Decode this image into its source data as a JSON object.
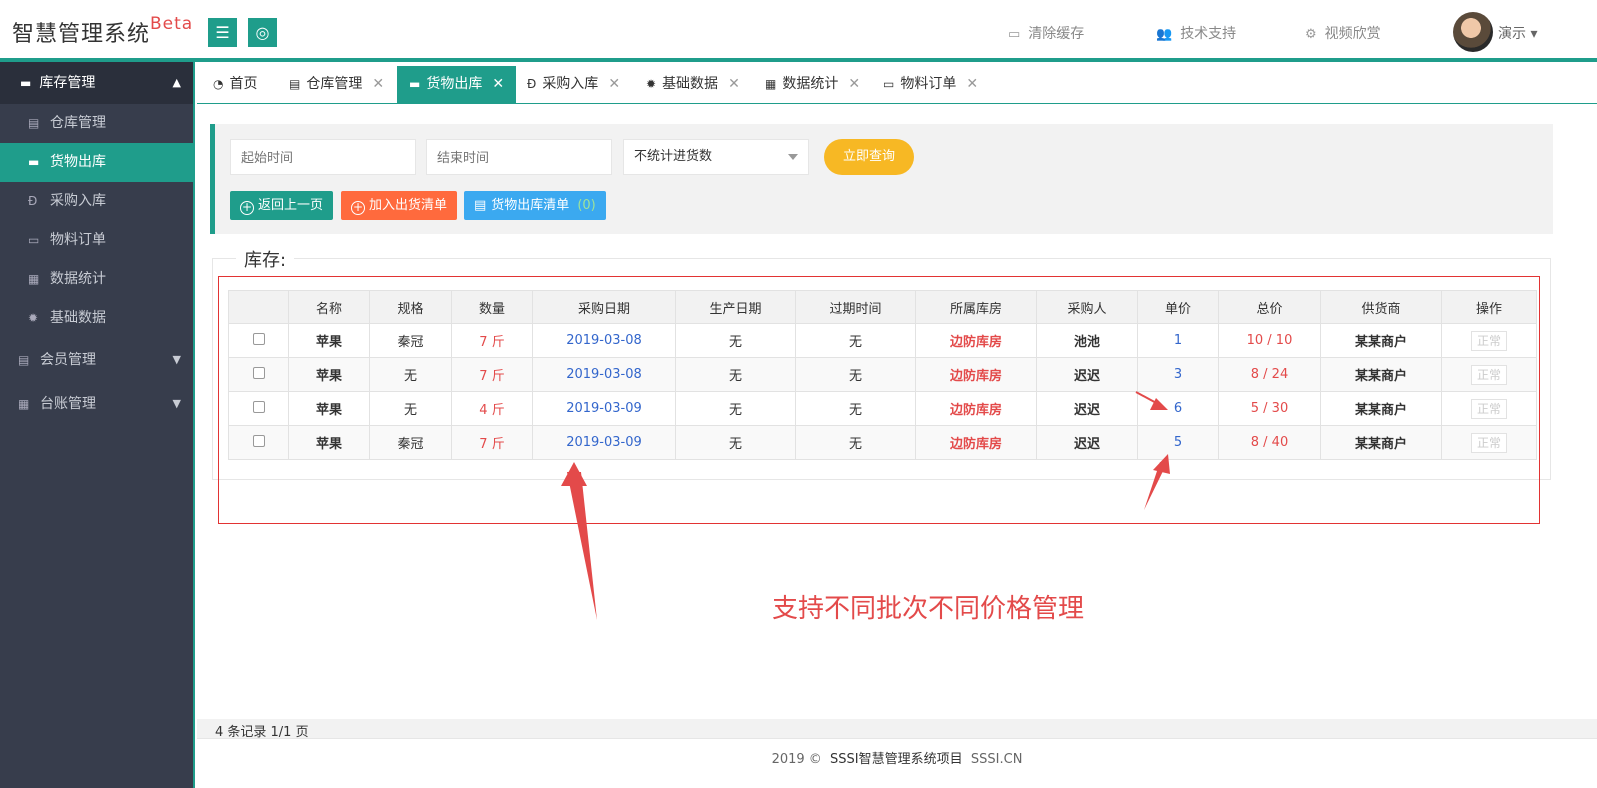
{
  "header": {
    "logo_text": "智慧管理系统",
    "logo_sup": "Beta",
    "menu_icon": "☰",
    "globe_icon": "◎",
    "links": [
      {
        "icon": "▭",
        "label": "清除缓存"
      },
      {
        "icon": "👥",
        "label": "技术支持"
      },
      {
        "icon": "⚙",
        "label": "视频欣赏"
      }
    ],
    "user_name": "演示 ▾"
  },
  "sidebar": {
    "group_open": {
      "icon": "▬",
      "label": "库存管理",
      "arrow": "▲"
    },
    "items": [
      {
        "icon": "▤",
        "label": "仓库管理"
      },
      {
        "icon": "▬",
        "label": "货物出库"
      },
      {
        "icon": "Ð",
        "label": "采购入库"
      },
      {
        "icon": "▭",
        "label": "物料订单"
      },
      {
        "icon": "▦",
        "label": "数据统计"
      },
      {
        "icon": "✹",
        "label": "基础数据"
      }
    ],
    "groups": [
      {
        "icon": "▤",
        "label": "会员管理",
        "arrow": "▼"
      },
      {
        "icon": "▦",
        "label": "台账管理",
        "arrow": "▼"
      }
    ]
  },
  "tabs": [
    {
      "icon": "◔",
      "label": "首页",
      "close": ""
    },
    {
      "icon": "▤",
      "label": "仓库管理",
      "close": "✕"
    },
    {
      "icon": "▬",
      "label": "货物出库",
      "close": "✕"
    },
    {
      "icon": "Ð",
      "label": "采购入库",
      "close": "✕"
    },
    {
      "icon": "✹",
      "label": "基础数据",
      "close": "✕"
    },
    {
      "icon": "▦",
      "label": "数据统计",
      "close": "✕"
    },
    {
      "icon": "▭",
      "label": "物料订单",
      "close": "✕"
    }
  ],
  "search": {
    "start_placeholder": "起始时间",
    "end_placeholder": "结束时间",
    "select_value": "不统计进货数",
    "query_label": "立即查询"
  },
  "actions": {
    "back_label": "返回上一页",
    "add_label": "加入出货清单",
    "list_label": "货物出库清单",
    "list_count": "(0)",
    "plus_icon": "+"
  },
  "section_title": "库存:",
  "table": {
    "headers": [
      "",
      "名称",
      "规格",
      "数量",
      "采购日期",
      "生产日期",
      "过期时间",
      "所属库房",
      "采购人",
      "单价",
      "总价",
      "供货商",
      "操作"
    ],
    "rows": [
      [
        "",
        "苹果",
        "秦冠",
        "7 斤",
        "2019-03-08",
        "无",
        "无",
        "边防库房",
        "池池",
        "1",
        "10 / 10",
        "某某商户",
        "正常"
      ],
      [
        "",
        "苹果",
        "无",
        "7 斤",
        "2019-03-08",
        "无",
        "无",
        "边防库房",
        "迟迟",
        "3",
        "8 / 24",
        "某某商户",
        "正常"
      ],
      [
        "",
        "苹果",
        "无",
        "4 斤",
        "2019-03-09",
        "无",
        "无",
        "边防库房",
        "迟迟",
        "6",
        "5 / 30",
        "某某商户",
        "正常"
      ],
      [
        "",
        "苹果",
        "秦冠",
        "7 斤",
        "2019-03-09",
        "无",
        "无",
        "边防库房",
        "迟迟",
        "5",
        "8 / 40",
        "某某商户",
        "正常"
      ]
    ]
  },
  "annotation": "支持不同批次不同价格管理",
  "footer": {
    "records": "4 条记录 1/1 页",
    "copyright_prefix": "2019 ©",
    "copyright_name": "SSSI智慧管理系统项目",
    "copyright_site": "SSSI.CN"
  },
  "colors": {
    "accent": "#1f9d8b",
    "query": "#f7b824",
    "add": "#ff6a3d",
    "list": "#3ba9f0",
    "highlight": "#e34a4a"
  }
}
